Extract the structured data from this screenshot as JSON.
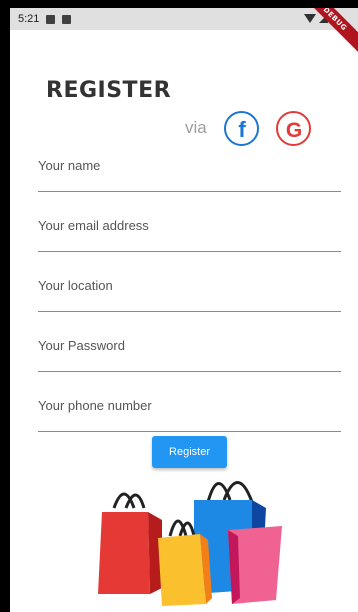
{
  "status_bar": {
    "time": "5:21"
  },
  "debug_banner": "DEBUG",
  "header": {
    "title": "REGISTER"
  },
  "social": {
    "via_label": "via",
    "facebook_glyph": "f",
    "google_glyph": "G"
  },
  "form": {
    "fields": [
      {
        "placeholder": "Your name",
        "value": ""
      },
      {
        "placeholder": "Your email address",
        "value": ""
      },
      {
        "placeholder": "Your location",
        "value": ""
      },
      {
        "placeholder": "Your Password",
        "value": ""
      },
      {
        "placeholder": "Your phone number",
        "value": ""
      }
    ],
    "submit_label": "Register"
  },
  "colors": {
    "accent": "#2196f3",
    "facebook": "#1976d2",
    "google": "#e53935",
    "debug": "#b0141e"
  },
  "icons": [
    "facebook-icon",
    "google-icon",
    "shopping-bags-illustration"
  ]
}
